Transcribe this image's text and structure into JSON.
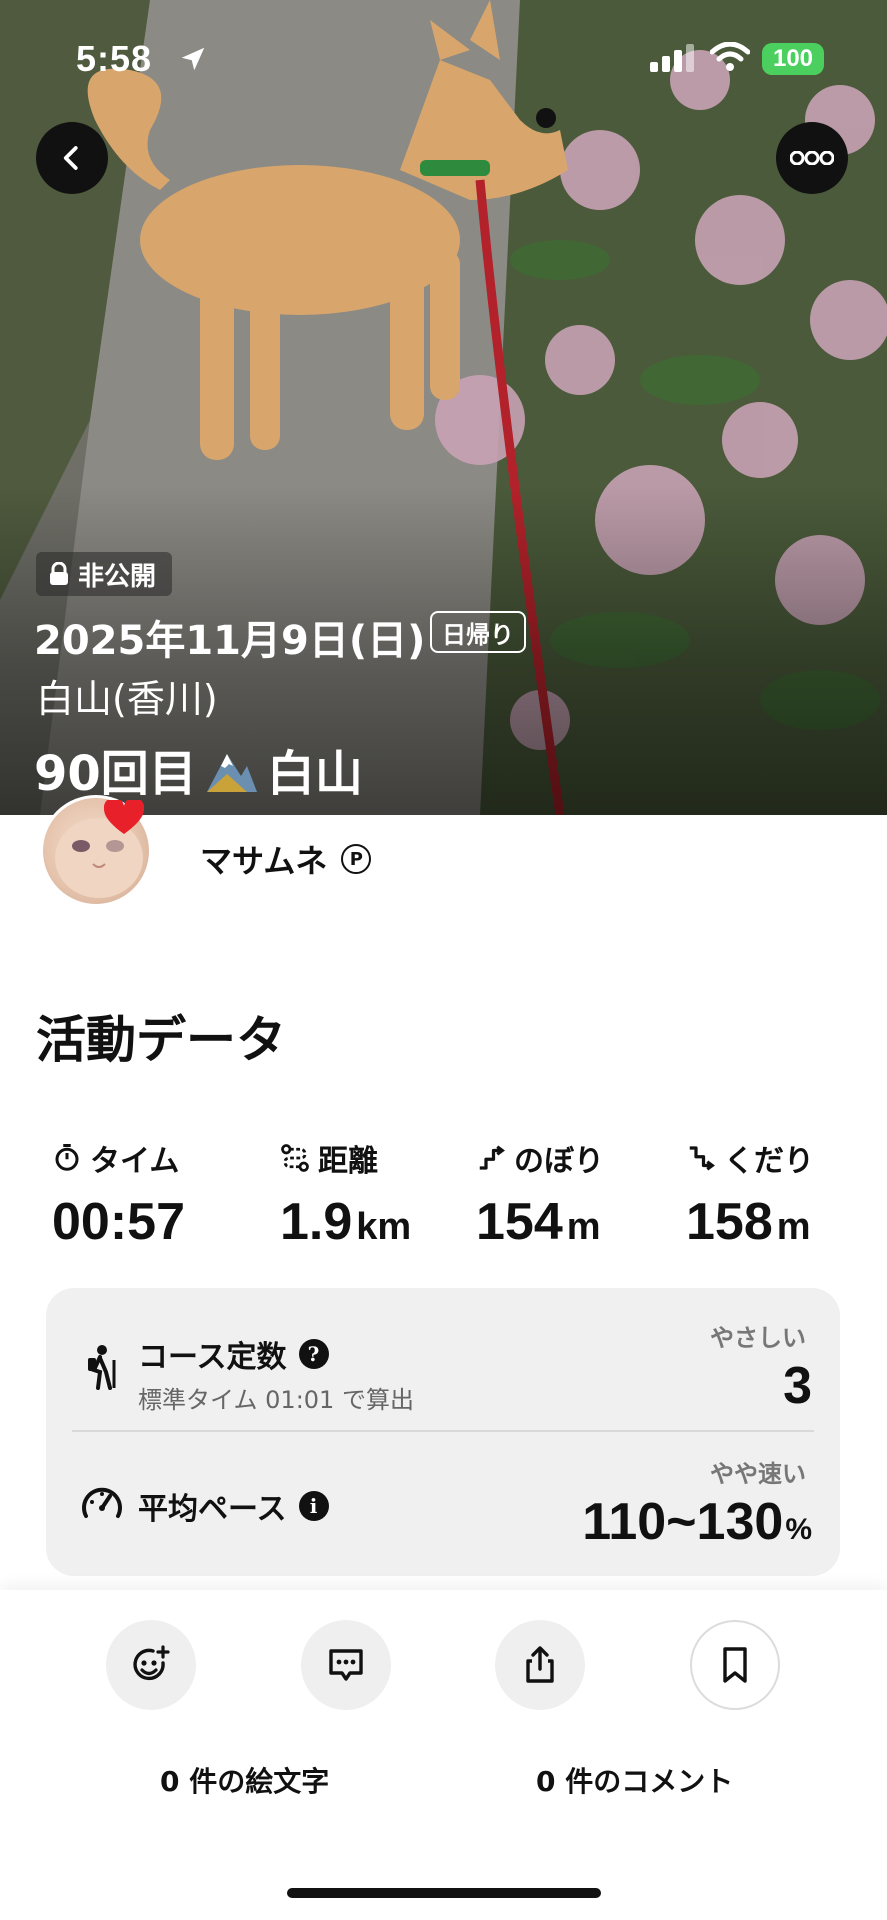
{
  "status_bar": {
    "time": "5:58",
    "battery": "100"
  },
  "hero": {
    "private_label": "非公開",
    "date": "2025年11月9日(日)",
    "trip_type": "日帰り",
    "place": "白山(香川)",
    "title_count": "90回目",
    "title_mountain": "白山"
  },
  "user": {
    "name": "マサムネ",
    "badge": "P"
  },
  "activity": {
    "section_title": "活動データ",
    "stats": [
      {
        "label": "タイム",
        "icon": "stopwatch-icon",
        "value": "00:57",
        "unit": ""
      },
      {
        "label": "距離",
        "icon": "route-icon",
        "value": "1.9",
        "unit": "km"
      },
      {
        "label": "のぼり",
        "icon": "ascent-icon",
        "value": "154",
        "unit": "m"
      },
      {
        "label": "くだり",
        "icon": "descent-icon",
        "value": "158",
        "unit": "m"
      }
    ],
    "course": {
      "label": "コース定数",
      "sub": "標準タイム 01:01 で算出",
      "grade": "やさしい",
      "value": "3"
    },
    "pace": {
      "label": "平均ペース",
      "grade": "やや速い",
      "value": "110~130",
      "unit": "%"
    }
  },
  "actions": {
    "emoji_count": "0 件の絵文字",
    "comment_count": "0 件のコメント"
  },
  "colors": {
    "battery": "#4bd05f",
    "card_bg": "#f0f0f0",
    "heart": "#e8202a"
  }
}
